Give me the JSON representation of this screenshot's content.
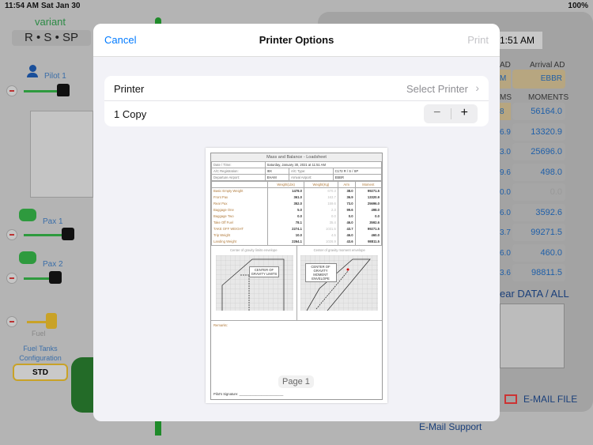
{
  "status": {
    "time": "11:54 AM",
    "date": "Sat Jan 30",
    "battery": "100%"
  },
  "background": {
    "variant_label": "variant",
    "variant_value": "R • S • SP",
    "pilot1": "Pilot 1",
    "pax1": "Pax 1",
    "pax2": "Pax 2",
    "fuel": "Fuel",
    "fuel_tanks": "Fuel Tanks Configuration",
    "fuel_tanks_value": "STD",
    "time_readout": "1:51 AM",
    "departure_ad_label": "AD",
    "departure_ad": "M",
    "arrival_ad_label": "Arrival AD",
    "arrival_ad": "EBBR",
    "arms_label": "MS",
    "moments_label": "MOMENTS",
    "arms": [
      "8",
      "6.9",
      "3.0",
      "9.6",
      "0.0",
      "6.0",
      "3.7",
      "6.0",
      "3.6"
    ],
    "moments": [
      "56164.0",
      "13320.9",
      "25696.0",
      "498.0",
      "0.0",
      "3592.6",
      "99271.5",
      "460.0",
      "98811.5"
    ],
    "clear_label": "ear DATA / ALL",
    "email_file": "E-MAIL FILE",
    "email_support": "E-Mail Support"
  },
  "modal": {
    "cancel": "Cancel",
    "title": "Printer Options",
    "print": "Print",
    "printer_label": "Printer",
    "printer_value": "Select Printer",
    "copies": "1 Copy",
    "page_label": "Page 1"
  },
  "loadsheet": {
    "title": "Mass and Balance - Loadsheet",
    "date_label": "Date / Time:",
    "date_value": "Saturday, January 30, 2021 at 11:51 AM",
    "reg_label": "A/C Registration:",
    "reg_value": "I9X",
    "type_label": "A/C Type:",
    "type_value": "C172 R / S / SP",
    "dep_label": "Departure Airport:",
    "dep_value": "EHAM",
    "arr_label": "Arrival Airport:",
    "arr_value": "EBBR",
    "headers": [
      "",
      "Weight(Lbs)",
      "Weight(Kg)",
      "Arm",
      "Moment"
    ],
    "rows": [
      [
        "Basic Empty Weight",
        "1478.0",
        "670.3",
        "38.0",
        "99271.5"
      ],
      [
        "Front Pax",
        "361.0",
        "163.7",
        "36.9",
        "13320.9"
      ],
      [
        "Rear Pax",
        "352.0",
        "159.6",
        "73.0",
        "25696.0"
      ],
      [
        "Baggage One",
        "5.0",
        "2.3",
        "99.6",
        "498.0"
      ],
      [
        "Baggage Two",
        "0.0",
        "0.0",
        "0.0",
        "0.0"
      ],
      [
        "Take Off Fuel",
        "78.1",
        "35.4",
        "46.0",
        "3592.6"
      ],
      [
        "TAKE OFF WEIGHT",
        "2274.1",
        "1031.5",
        "43.7",
        "99271.5"
      ],
      [
        "Trip Weight",
        "10.0",
        "4.5",
        "46.0",
        "460.0"
      ],
      [
        "Landing Weight",
        "2264.1",
        "1026.9",
        "43.6",
        "98811.5"
      ]
    ],
    "chart1_title": "Center of gravity limits envelope",
    "chart1_box": "CENTER OF GRAVITY LIMITS",
    "chart2_title": "Center of gravity moment envelope",
    "chart2_box": "CENTER OF GRAVITY MOMENT ENVELOPE",
    "remarks": "Remarks:",
    "signature": "Pilot's Signature:"
  }
}
